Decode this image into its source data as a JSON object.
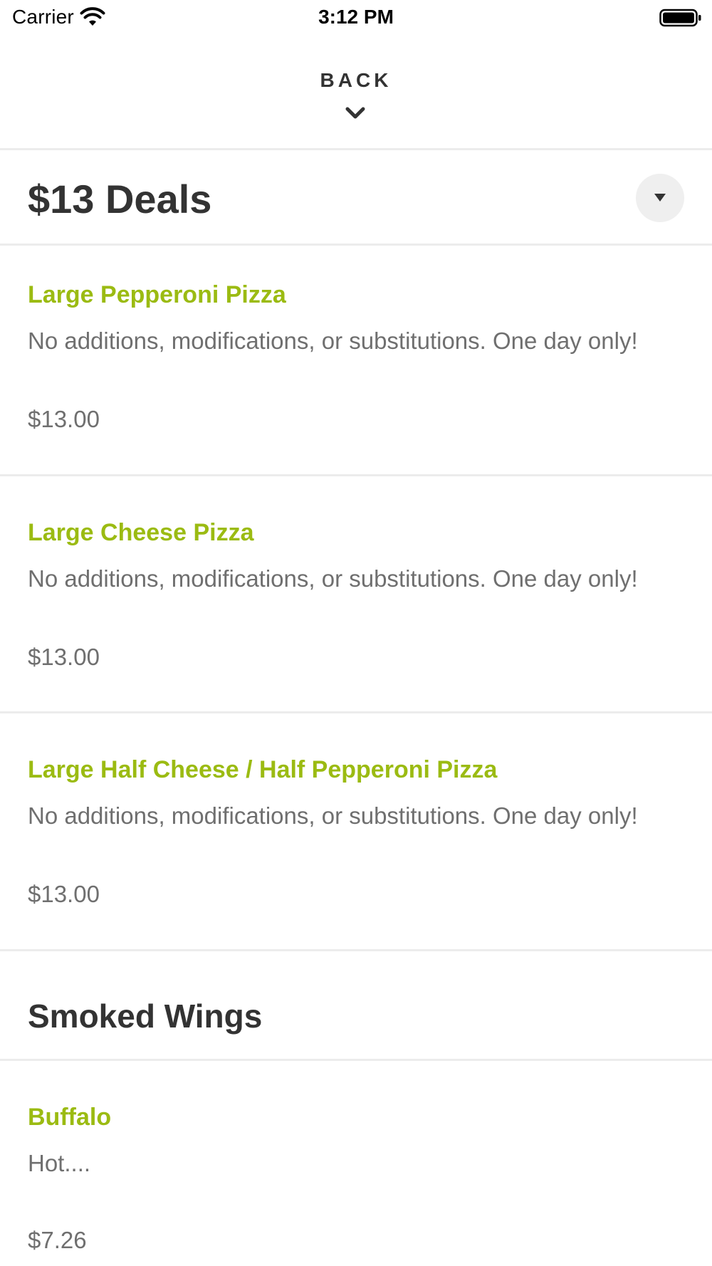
{
  "status_bar": {
    "carrier": "Carrier",
    "time": "3:12 PM",
    "wifi_icon": "wifi-icon",
    "battery_icon": "battery-icon"
  },
  "header": {
    "back_label": "BACK",
    "chevron_icon": "chevron-down-icon"
  },
  "colors": {
    "item_name": "#9bbb12",
    "heading": "#333333",
    "body_text": "#6f6f6f",
    "divider": "#ececec"
  },
  "sections": [
    {
      "title": "$13 Deals",
      "dropdown_icon": "caret-down-icon",
      "items": [
        {
          "name": "Large Pepperoni Pizza",
          "description": "No additions, modifications, or substitutions. One day only!",
          "price": "$13.00"
        },
        {
          "name": "Large Cheese Pizza",
          "description": "No additions, modifications, or substitutions. One day only!",
          "price": "$13.00"
        },
        {
          "name": "Large Half Cheese / Half Pepperoni Pizza",
          "description": "No additions, modifications, or substitutions. One day only!",
          "price": "$13.00"
        }
      ]
    },
    {
      "title": "Smoked Wings",
      "items": [
        {
          "name": "Buffalo",
          "description": "Hot....",
          "price": "$7.26"
        }
      ]
    }
  ]
}
